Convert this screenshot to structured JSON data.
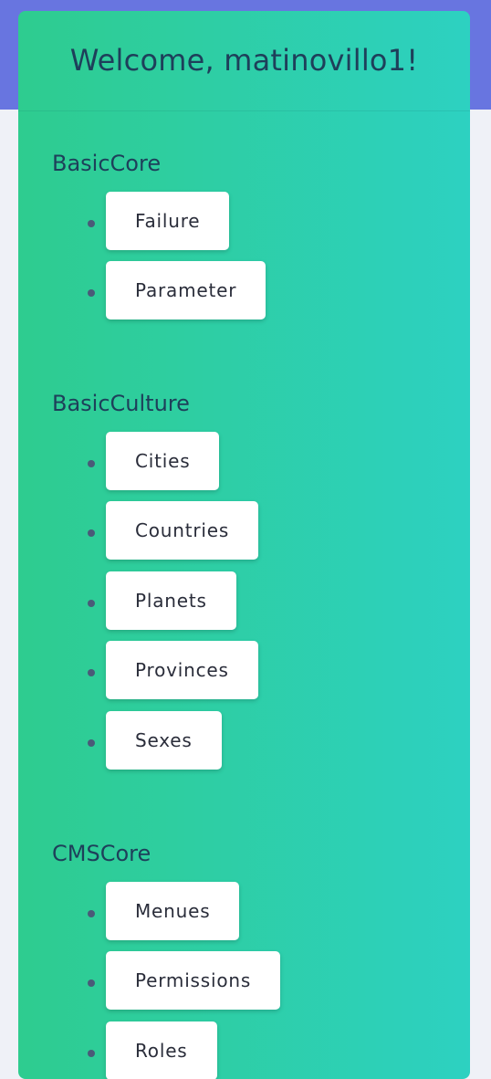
{
  "header": {
    "welcome": "Welcome, matinovillo1!"
  },
  "sections": [
    {
      "title": "BasicCore",
      "items": [
        "Failure",
        "Parameter"
      ]
    },
    {
      "title": "BasicCulture",
      "items": [
        "Cities",
        "Countries",
        "Planets",
        "Provinces",
        "Sexes"
      ]
    },
    {
      "title": "CMSCore",
      "items": [
        "Menues",
        "Permissions",
        "Roles"
      ]
    }
  ],
  "colors": {
    "top_band": "#6875e0",
    "card_gradient_start": "#2ecc8f",
    "card_gradient_end": "#2dd1c1",
    "heading_text": "#1e3f5a",
    "button_bg": "#ffffff"
  }
}
